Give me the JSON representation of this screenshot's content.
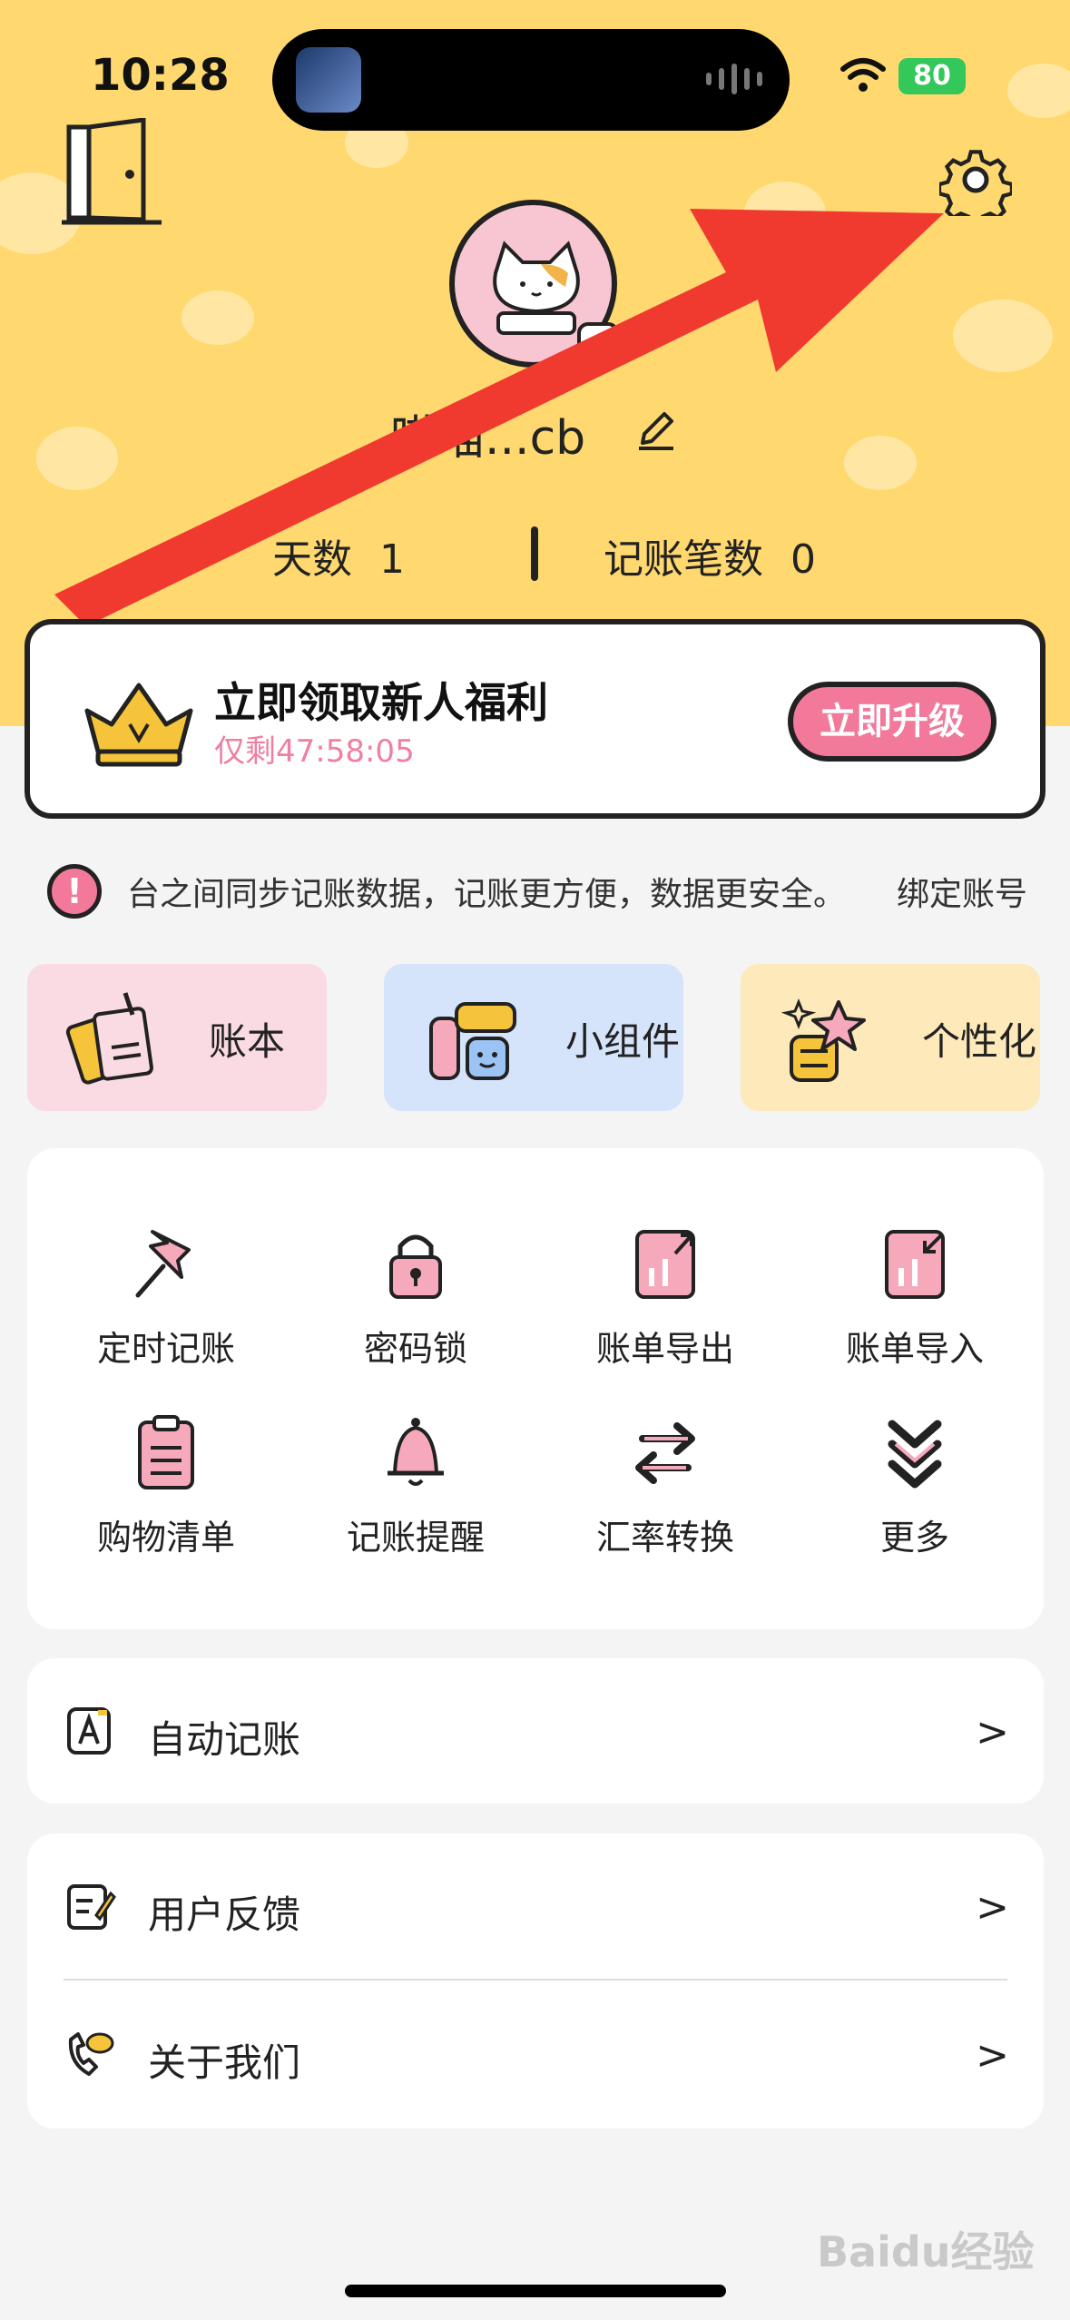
{
  "status_bar": {
    "time": "10:28",
    "battery": "80"
  },
  "profile": {
    "username": "喵喵...cb",
    "stats": [
      {
        "label": "天数",
        "value": "1"
      },
      {
        "label": "记账笔数",
        "value": "0"
      }
    ]
  },
  "promo": {
    "title": "立即领取新人福利",
    "countdown": "仅剩47:58:05",
    "button": "立即升级"
  },
  "notice": {
    "text": "台之间同步记账数据，记账更方便，数据更安全。",
    "link": "绑定账号"
  },
  "quick_actions": [
    {
      "label": "账本",
      "icon": "ledger-icon"
    },
    {
      "label": "小组件",
      "icon": "widget-icon"
    },
    {
      "label": "个性化",
      "icon": "personalize-icon"
    }
  ],
  "tools": [
    {
      "label": "定时记账",
      "icon": "pin-icon"
    },
    {
      "label": "密码锁",
      "icon": "lock-icon"
    },
    {
      "label": "账单导出",
      "icon": "export-icon"
    },
    {
      "label": "账单导入",
      "icon": "import-icon"
    },
    {
      "label": "购物清单",
      "icon": "clipboard-icon"
    },
    {
      "label": "记账提醒",
      "icon": "bell-icon"
    },
    {
      "label": "汇率转换",
      "icon": "exchange-icon"
    },
    {
      "label": "更多",
      "icon": "more-chevron-icon"
    }
  ],
  "list": {
    "auto_bookkeeping": "自动记账",
    "feedback": "用户反馈",
    "about": "关于我们",
    "chevron": ">"
  },
  "watermark": "Baidu经验",
  "colors": {
    "header_bg": "#ffd86f",
    "accent_pink": "#f2799a",
    "arrow_red": "#f03a30"
  }
}
